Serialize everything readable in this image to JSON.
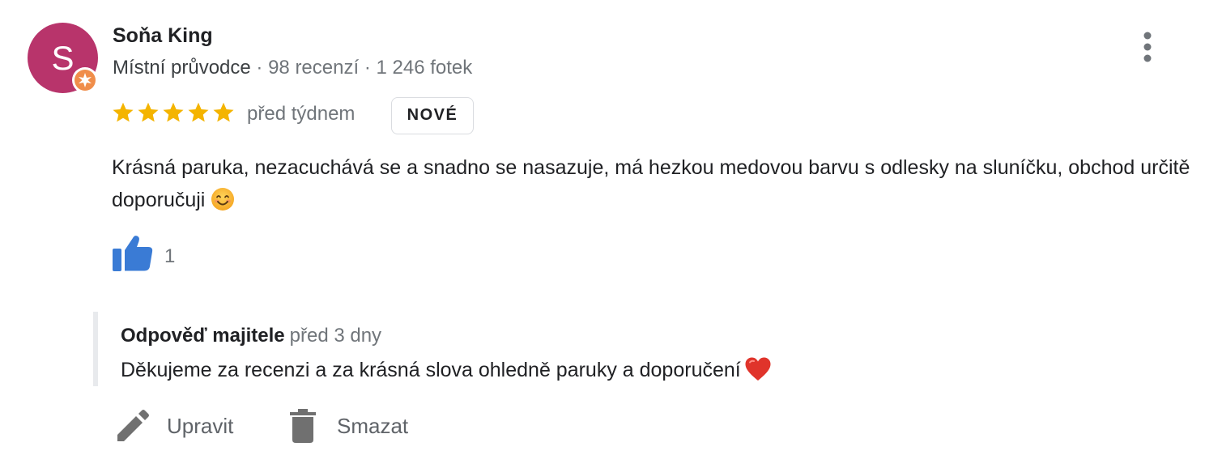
{
  "review": {
    "author": {
      "name": "Soňa King",
      "initial": "S",
      "role": "Místní průvodce",
      "reviews": "98 recenzí",
      "photos": "1 246 fotek",
      "separator": " · ",
      "avatar_color": "#b8346b",
      "badge_color": "#f08d4a"
    },
    "rating": 5,
    "star_color": "#f4b400",
    "time": "před týdnem",
    "badge": "NOVÉ",
    "text": "Krásná paruka, nezacuchává se a snadno se nasazuje, má hezkou medovou barvu s odlesky na sluníčku, obchod určitě doporučuji",
    "text_emoji": "smiling-face-emoji",
    "like_icon": "thumbs-up-icon",
    "like_color": "#3a7bd5",
    "likes": "1",
    "more_icon": "three-dots-vertical-icon"
  },
  "owner_reply": {
    "title": "Odpověď majitele",
    "time": "před 3 dny",
    "text": "Děkujeme za recenzi a za krásná slova ohledně paruky a doporučení",
    "text_emoji": "red-heart-emoji"
  },
  "actions": {
    "edit_label": "Upravit",
    "edit_icon": "pencil-icon",
    "delete_label": "Smazat",
    "delete_icon": "trash-icon"
  }
}
